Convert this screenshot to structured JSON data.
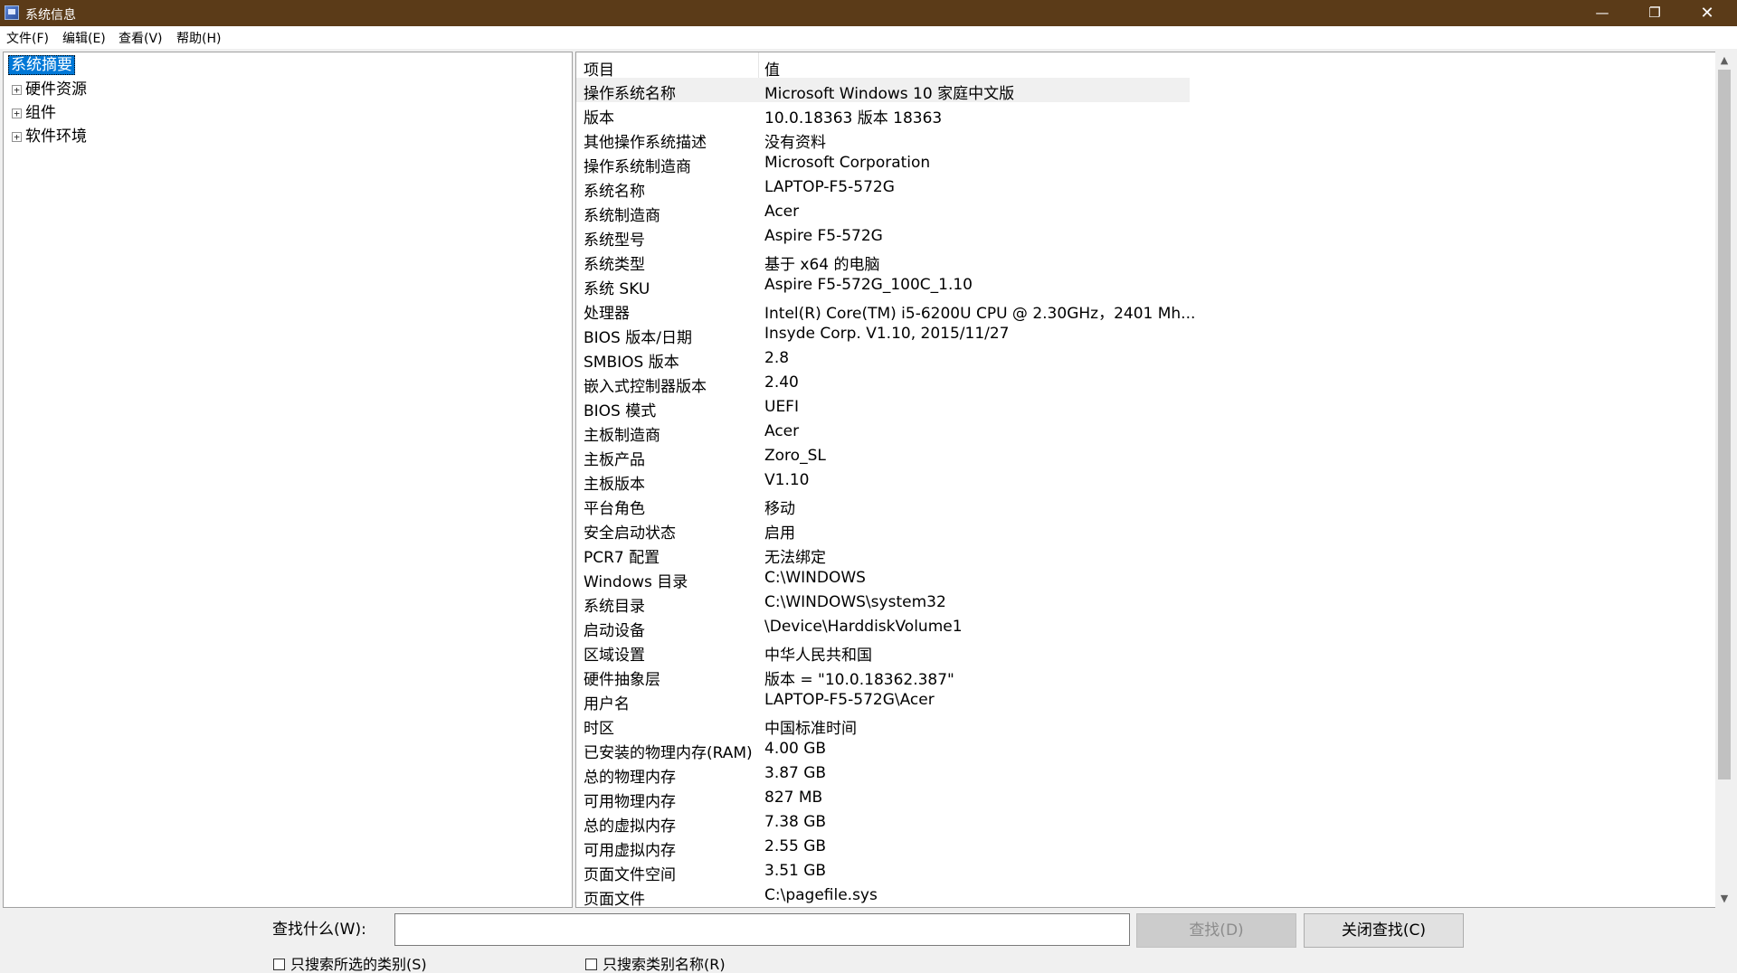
{
  "window": {
    "title": "系统信息",
    "min_glyph": "—",
    "max_glyph": "❐",
    "close_glyph": "✕"
  },
  "menu": [
    "文件(F)",
    "编辑(E)",
    "查看(V)",
    "帮助(H)"
  ],
  "tree": {
    "root": "系统摘要",
    "children": [
      "硬件资源",
      "组件",
      "软件环境"
    ],
    "expander_glyph": "+"
  },
  "list": {
    "header_item": "项目",
    "header_value": "值",
    "rows": [
      [
        "操作系统名称",
        "Microsoft Windows 10 家庭中文版"
      ],
      [
        "版本",
        "10.0.18363 版本 18363"
      ],
      [
        "其他操作系统描述",
        "没有资料"
      ],
      [
        "操作系统制造商",
        "Microsoft Corporation"
      ],
      [
        "系统名称",
        "LAPTOP-F5-572G"
      ],
      [
        "系统制造商",
        "Acer"
      ],
      [
        "系统型号",
        "Aspire F5-572G"
      ],
      [
        "系统类型",
        "基于 x64 的电脑"
      ],
      [
        "系统 SKU",
        "Aspire F5-572G_100C_1.10"
      ],
      [
        "处理器",
        "Intel(R) Core(TM) i5-6200U CPU @ 2.30GHz，2401 Mh..."
      ],
      [
        "BIOS 版本/日期",
        "Insyde Corp. V1.10, 2015/11/27"
      ],
      [
        "SMBIOS 版本",
        "2.8"
      ],
      [
        "嵌入式控制器版本",
        "2.40"
      ],
      [
        "BIOS 模式",
        "UEFI"
      ],
      [
        "主板制造商",
        "Acer"
      ],
      [
        "主板产品",
        "Zoro_SL"
      ],
      [
        "主板版本",
        "V1.10"
      ],
      [
        "平台角色",
        "移动"
      ],
      [
        "安全启动状态",
        "启用"
      ],
      [
        "PCR7 配置",
        "无法绑定"
      ],
      [
        "Windows 目录",
        "C:\\WINDOWS"
      ],
      [
        "系统目录",
        "C:\\WINDOWS\\system32"
      ],
      [
        "启动设备",
        "\\Device\\HarddiskVolume1"
      ],
      [
        "区域设置",
        "中华人民共和国"
      ],
      [
        "硬件抽象层",
        "版本 = \"10.0.18362.387\""
      ],
      [
        "用户名",
        "LAPTOP-F5-572G\\Acer"
      ],
      [
        "时区",
        "中国标准时间"
      ],
      [
        "已安装的物理内存(RAM)",
        "4.00 GB"
      ],
      [
        "总的物理内存",
        "3.87 GB"
      ],
      [
        "可用物理内存",
        "827 MB"
      ],
      [
        "总的虚拟内存",
        "7.38 GB"
      ],
      [
        "可用虚拟内存",
        "2.55 GB"
      ],
      [
        "页面文件空间",
        "3.51 GB"
      ],
      [
        "页面文件",
        "C:\\pagefile.sys"
      ]
    ]
  },
  "scroll": {
    "up_glyph": "▲",
    "down_glyph": "▼"
  },
  "find": {
    "label": "查找什么(W):",
    "input_value": "",
    "find_button": "查找(D)",
    "close_button": "关闭查找(C)",
    "check_selected_category": "只搜索所选的类别(S)",
    "check_category_names": "只搜索类别名称(R)"
  }
}
